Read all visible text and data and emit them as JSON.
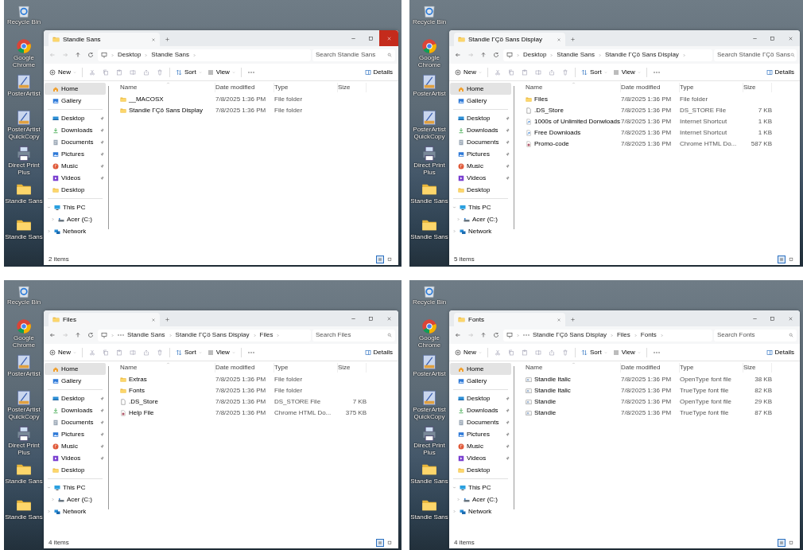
{
  "panels": [
    {
      "desktop_icons": [
        {
          "label": "Recycle Bin",
          "kind": "recycle"
        },
        {
          "label": "Google Chrome",
          "kind": "chrome"
        },
        {
          "label": "PosterArtist",
          "kind": "app"
        },
        {
          "label": "PosterArtist QuickCopy",
          "kind": "app"
        },
        {
          "label": "Direct Print Plus",
          "kind": "printer"
        },
        {
          "label": "Standie Sans",
          "kind": "folder"
        },
        {
          "label": "Standie Sans",
          "kind": "folder"
        }
      ],
      "window": {
        "tab_title": "Standie Sans",
        "close_highlighted": true,
        "back_enabled": false,
        "breadcrumb_overflow": false,
        "breadcrumbs": [
          "Desktop",
          "Standie Sans"
        ],
        "search": {
          "placeholder": "Search Standie Sans"
        },
        "toolbar": {
          "new": "New",
          "sort": "Sort",
          "view": "View",
          "details": "Details"
        },
        "sidebar": {
          "quick": [
            {
              "label": "Home",
              "kind": "home",
              "selected": true
            },
            {
              "label": "Gallery",
              "kind": "gallery",
              "selected": false
            }
          ],
          "pinned": [
            {
              "label": "Desktop",
              "kind": "desktop",
              "pinned": true
            },
            {
              "label": "Downloads",
              "kind": "downloads",
              "pinned": true
            },
            {
              "label": "Documents",
              "kind": "documents",
              "pinned": true
            },
            {
              "label": "Pictures",
              "kind": "pictures",
              "pinned": true
            },
            {
              "label": "Music",
              "kind": "music",
              "pinned": true
            },
            {
              "label": "Videos",
              "kind": "videos",
              "pinned": true
            },
            {
              "label": "Desktop",
              "kind": "folder",
              "pinned": false
            }
          ],
          "tree": [
            {
              "label": "This PC",
              "kind": "pc",
              "expanded": true,
              "children": [
                {
                  "label": "Acer (C:)",
                  "kind": "drive",
                  "expanded": false
                }
              ]
            },
            {
              "label": "Network",
              "kind": "network",
              "expanded": false
            }
          ]
        },
        "columns": [
          "Name",
          "Date modified",
          "Type",
          "Size"
        ],
        "rows": [
          {
            "name": "__MACOSX",
            "kind": "folder",
            "date": "7/8/2025 1:36 PM",
            "type": "File folder"
          },
          {
            "name": "Standie ΓÇö Sans Display",
            "kind": "folder",
            "date": "7/8/2025 1:36 PM",
            "type": "File folder"
          }
        ],
        "status": "2 items"
      }
    },
    {
      "desktop_icons": [
        {
          "label": "Recycle Bin",
          "kind": "recycle"
        },
        {
          "label": "Google Chrome",
          "kind": "chrome"
        },
        {
          "label": "PosterArtist",
          "kind": "app"
        },
        {
          "label": "PosterArtist QuickCopy",
          "kind": "app"
        },
        {
          "label": "Direct Print Plus",
          "kind": "printer"
        },
        {
          "label": "Standie Sans",
          "kind": "folder"
        },
        {
          "label": "Standie Sans",
          "kind": "folder"
        }
      ],
      "window": {
        "tab_title": "Standie ΓÇö Sans Display",
        "close_highlighted": false,
        "back_enabled": true,
        "breadcrumb_overflow": false,
        "breadcrumbs": [
          "Desktop",
          "Standie Sans",
          "Standie ΓÇö Sans Display"
        ],
        "search": {
          "placeholder": "Search Standie ΓÇö Sans"
        },
        "toolbar": {
          "new": "New",
          "sort": "Sort",
          "view": "View",
          "details": "Details"
        },
        "sidebar": {
          "quick": [
            {
              "label": "Home",
              "kind": "home",
              "selected": true
            },
            {
              "label": "Gallery",
              "kind": "gallery",
              "selected": false
            }
          ],
          "pinned": [
            {
              "label": "Desktop",
              "kind": "desktop",
              "pinned": true
            },
            {
              "label": "Downloads",
              "kind": "downloads",
              "pinned": true
            },
            {
              "label": "Documents",
              "kind": "documents",
              "pinned": true
            },
            {
              "label": "Pictures",
              "kind": "pictures",
              "pinned": true
            },
            {
              "label": "Music",
              "kind": "music",
              "pinned": true
            },
            {
              "label": "Videos",
              "kind": "videos",
              "pinned": true
            },
            {
              "label": "Desktop",
              "kind": "folder",
              "pinned": false
            }
          ],
          "tree": [
            {
              "label": "This PC",
              "kind": "pc",
              "expanded": true,
              "children": [
                {
                  "label": "Acer (C:)",
                  "kind": "drive",
                  "expanded": false
                }
              ]
            },
            {
              "label": "Network",
              "kind": "network",
              "expanded": false
            }
          ]
        },
        "columns": [
          "Name",
          "Date modified",
          "Type",
          "Size"
        ],
        "rows": [
          {
            "name": "Files",
            "kind": "folder",
            "date": "7/8/2025 1:36 PM",
            "type": "File folder"
          },
          {
            "name": ".DS_Store",
            "kind": "file",
            "date": "7/8/2025 1:36 PM",
            "type": "DS_STORE File",
            "size": "7 KB"
          },
          {
            "name": "1000s of Unlimited Donwloads",
            "kind": "shortcut",
            "date": "7/8/2025 1:36 PM",
            "type": "Internet Shortcut",
            "size": "1 KB"
          },
          {
            "name": "Free Downloads",
            "kind": "shortcut",
            "date": "7/8/2025 1:36 PM",
            "type": "Internet Shortcut",
            "size": "1 KB"
          },
          {
            "name": "Promo-code",
            "kind": "html",
            "date": "7/8/2025 1:36 PM",
            "type": "Chrome HTML Do...",
            "size": "587 KB"
          }
        ],
        "status": "5 items"
      }
    },
    {
      "desktop_icons": [
        {
          "label": "Recycle Bin",
          "kind": "recycle"
        },
        {
          "label": "Google Chrome",
          "kind": "chrome"
        },
        {
          "label": "PosterArtist",
          "kind": "app"
        },
        {
          "label": "PosterArtist QuickCopy",
          "kind": "app"
        },
        {
          "label": "Direct Print Plus",
          "kind": "printer"
        },
        {
          "label": "Standie Sans",
          "kind": "folder"
        },
        {
          "label": "Standie Sans",
          "kind": "folder"
        }
      ],
      "window": {
        "tab_title": "Files",
        "close_highlighted": false,
        "back_enabled": true,
        "breadcrumb_overflow": true,
        "breadcrumbs": [
          "Standie Sans",
          "Standie ΓÇö Sans Display",
          "Files"
        ],
        "search": {
          "placeholder": "Search Files"
        },
        "toolbar": {
          "new": "New",
          "sort": "Sort",
          "view": "View",
          "details": "Details"
        },
        "sidebar": {
          "quick": [
            {
              "label": "Home",
              "kind": "home",
              "selected": true
            },
            {
              "label": "Gallery",
              "kind": "gallery",
              "selected": false
            }
          ],
          "pinned": [
            {
              "label": "Desktop",
              "kind": "desktop",
              "pinned": true
            },
            {
              "label": "Downloads",
              "kind": "downloads",
              "pinned": true
            },
            {
              "label": "Documents",
              "kind": "documents",
              "pinned": true
            },
            {
              "label": "Pictures",
              "kind": "pictures",
              "pinned": true
            },
            {
              "label": "Music",
              "kind": "music",
              "pinned": true
            },
            {
              "label": "Videos",
              "kind": "videos",
              "pinned": true
            },
            {
              "label": "Desktop",
              "kind": "folder",
              "pinned": false
            }
          ],
          "tree": [
            {
              "label": "This PC",
              "kind": "pc",
              "expanded": true,
              "children": [
                {
                  "label": "Acer (C:)",
                  "kind": "drive",
                  "expanded": false
                }
              ]
            },
            {
              "label": "Network",
              "kind": "network",
              "expanded": false
            }
          ]
        },
        "columns": [
          "Name",
          "Date modified",
          "Type",
          "Size"
        ],
        "rows": [
          {
            "name": "Extras",
            "kind": "folder",
            "date": "7/8/2025 1:36 PM",
            "type": "File folder"
          },
          {
            "name": "Fonts",
            "kind": "folder",
            "date": "7/8/2025 1:36 PM",
            "type": "File folder"
          },
          {
            "name": ".DS_Store",
            "kind": "file",
            "date": "7/8/2025 1:36 PM",
            "type": "DS_STORE File",
            "size": "7 KB"
          },
          {
            "name": "Help File",
            "kind": "html",
            "date": "7/8/2025 1:36 PM",
            "type": "Chrome HTML Do...",
            "size": "375 KB"
          }
        ],
        "status": "4 items"
      }
    },
    {
      "desktop_icons": [
        {
          "label": "Recycle Bin",
          "kind": "recycle"
        },
        {
          "label": "Google Chrome",
          "kind": "chrome"
        },
        {
          "label": "PosterArtist",
          "kind": "app"
        },
        {
          "label": "PosterArtist QuickCopy",
          "kind": "app"
        },
        {
          "label": "Direct Print Plus",
          "kind": "printer"
        },
        {
          "label": "Standie Sans",
          "kind": "folder"
        },
        {
          "label": "Standie Sans",
          "kind": "folder"
        }
      ],
      "window": {
        "tab_title": "Fonts",
        "close_highlighted": false,
        "back_enabled": true,
        "breadcrumb_overflow": true,
        "breadcrumbs": [
          "Standie ΓÇö Sans Display",
          "Files",
          "Fonts"
        ],
        "search": {
          "placeholder": "Search Fonts"
        },
        "toolbar": {
          "new": "New",
          "sort": "Sort",
          "view": "View",
          "details": "Details"
        },
        "sidebar": {
          "quick": [
            {
              "label": "Home",
              "kind": "home",
              "selected": true
            },
            {
              "label": "Gallery",
              "kind": "gallery",
              "selected": false
            }
          ],
          "pinned": [
            {
              "label": "Desktop",
              "kind": "desktop",
              "pinned": true
            },
            {
              "label": "Downloads",
              "kind": "downloads",
              "pinned": true
            },
            {
              "label": "Documents",
              "kind": "documents",
              "pinned": true
            },
            {
              "label": "Pictures",
              "kind": "pictures",
              "pinned": true
            },
            {
              "label": "Music",
              "kind": "music",
              "pinned": true
            },
            {
              "label": "Videos",
              "kind": "videos",
              "pinned": true
            },
            {
              "label": "Desktop",
              "kind": "folder",
              "pinned": false
            }
          ],
          "tree": [
            {
              "label": "This PC",
              "kind": "pc",
              "expanded": true,
              "children": [
                {
                  "label": "Acer (C:)",
                  "kind": "drive",
                  "expanded": false
                }
              ]
            },
            {
              "label": "Network",
              "kind": "network",
              "expanded": false
            }
          ]
        },
        "columns": [
          "Name",
          "Date modified",
          "Type",
          "Size"
        ],
        "rows": [
          {
            "name": "Standie Italic",
            "kind": "font",
            "date": "7/8/2025 1:36 PM",
            "type": "OpenType font file",
            "size": "38 KB"
          },
          {
            "name": "Standie Italic",
            "kind": "font",
            "date": "7/8/2025 1:36 PM",
            "type": "TrueType font file",
            "size": "82 KB"
          },
          {
            "name": "Standie",
            "kind": "font",
            "date": "7/8/2025 1:36 PM",
            "type": "OpenType font file",
            "size": "29 KB"
          },
          {
            "name": "Standie",
            "kind": "font",
            "date": "7/8/2025 1:36 PM",
            "type": "TrueType font file",
            "size": "87 KB"
          }
        ],
        "status": "4 items"
      }
    }
  ]
}
